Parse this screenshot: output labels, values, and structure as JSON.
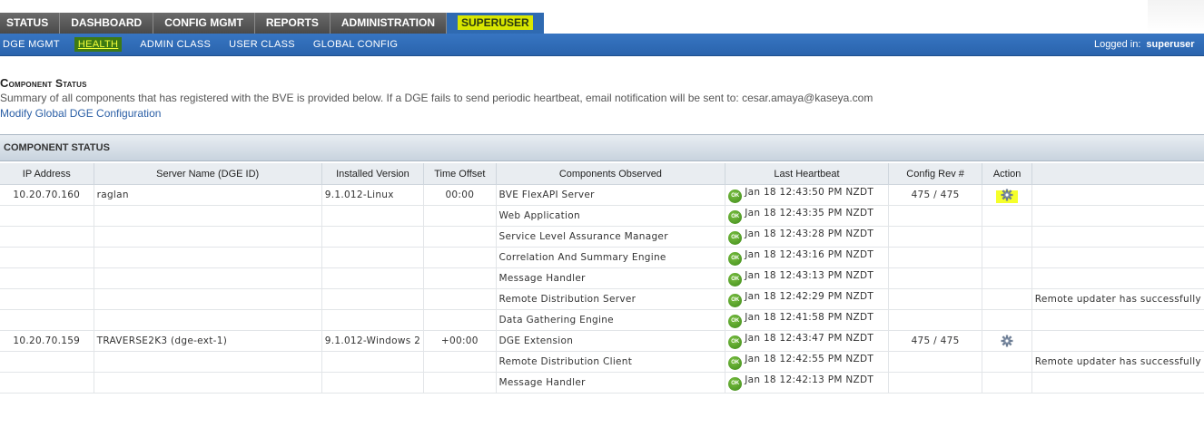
{
  "topnav": {
    "tabs": [
      {
        "label": "STATUS"
      },
      {
        "label": "DASHBOARD"
      },
      {
        "label": "CONFIG MGMT"
      },
      {
        "label": "REPORTS"
      },
      {
        "label": "ADMINISTRATION"
      },
      {
        "label": "SUPERUSER",
        "active": true
      }
    ]
  },
  "subnav": {
    "links": [
      {
        "label": "DGE MGMT"
      },
      {
        "label": "HEALTH",
        "active": true
      },
      {
        "label": "ADMIN CLASS"
      },
      {
        "label": "USER CLASS"
      },
      {
        "label": "GLOBAL CONFIG"
      }
    ],
    "logged_in_label": "Logged in:",
    "user": "superuser"
  },
  "page": {
    "title": "Component Status",
    "summary": "Summary of all components that has registered with the BVE is provided below. If a DGE fails to send periodic heartbeat, email notification will be sent to: cesar.amaya@kaseya.com",
    "modify_link": "Modify Global DGE Configuration"
  },
  "panel": {
    "title": "COMPONENT STATUS",
    "columns": [
      "IP Address",
      "Server Name (DGE ID)",
      "Installed Version",
      "Time Offset",
      "Components Observed",
      "Last Heartbeat",
      "Config Rev #",
      "Action",
      ""
    ],
    "rows": [
      {
        "ip": "10.20.70.160",
        "server": "raglan",
        "version": "9.1.012-Linux",
        "offset": "00:00",
        "component": "BVE FlexAPI Server",
        "heartbeat": "Jan 18 12:43:50 PM NZDT",
        "config_rev": "475 / 475",
        "action": "gear",
        "message": ""
      },
      {
        "ip": "",
        "server": "",
        "version": "",
        "offset": "",
        "component": "Web Application",
        "heartbeat": "Jan 18 12:43:35 PM NZDT",
        "config_rev": "",
        "action": "",
        "message": ""
      },
      {
        "ip": "",
        "server": "",
        "version": "",
        "offset": "",
        "component": "Service Level Assurance Manager",
        "heartbeat": "Jan 18 12:43:28 PM NZDT",
        "config_rev": "",
        "action": "",
        "message": ""
      },
      {
        "ip": "",
        "server": "",
        "version": "",
        "offset": "",
        "component": "Correlation And Summary Engine",
        "heartbeat": "Jan 18 12:43:16 PM NZDT",
        "config_rev": "",
        "action": "",
        "message": ""
      },
      {
        "ip": "",
        "server": "",
        "version": "",
        "offset": "",
        "component": "Message Handler",
        "heartbeat": "Jan 18 12:43:13 PM NZDT",
        "config_rev": "",
        "action": "",
        "message": ""
      },
      {
        "ip": "",
        "server": "",
        "version": "",
        "offset": "",
        "component": "Remote Distribution Server",
        "heartbeat": "Jan 18 12:42:29 PM NZDT",
        "config_rev": "",
        "action": "",
        "message": "Remote updater has successfully"
      },
      {
        "ip": "",
        "server": "",
        "version": "",
        "offset": "",
        "component": "Data Gathering Engine",
        "heartbeat": "Jan 18 12:41:58 PM NZDT",
        "config_rev": "",
        "action": "",
        "message": ""
      },
      {
        "ip": "10.20.70.159",
        "server": "TRAVERSE2K3 (dge-ext-1)",
        "version": "9.1.012-Windows 2",
        "offset": "+00:00",
        "component": "DGE Extension",
        "heartbeat": "Jan 18 12:43:47 PM NZDT",
        "config_rev": "475 / 475",
        "action": "gear",
        "message": ""
      },
      {
        "ip": "",
        "server": "",
        "version": "",
        "offset": "",
        "component": "Remote Distribution Client",
        "heartbeat": "Jan 18 12:42:55 PM NZDT",
        "config_rev": "",
        "action": "",
        "message": "Remote updater has successfully"
      },
      {
        "ip": "",
        "server": "",
        "version": "",
        "offset": "",
        "component": "Message Handler",
        "heartbeat": "Jan 18 12:42:13 PM NZDT",
        "config_rev": "",
        "action": "",
        "message": ""
      }
    ],
    "status_icon_text": "OK"
  },
  "colors": {
    "subnav_blue": "#2f6ab1",
    "highlight_yellow": "#f5ff2a",
    "ok_green": "#4f9a22",
    "link_blue": "#2b5fa6"
  }
}
